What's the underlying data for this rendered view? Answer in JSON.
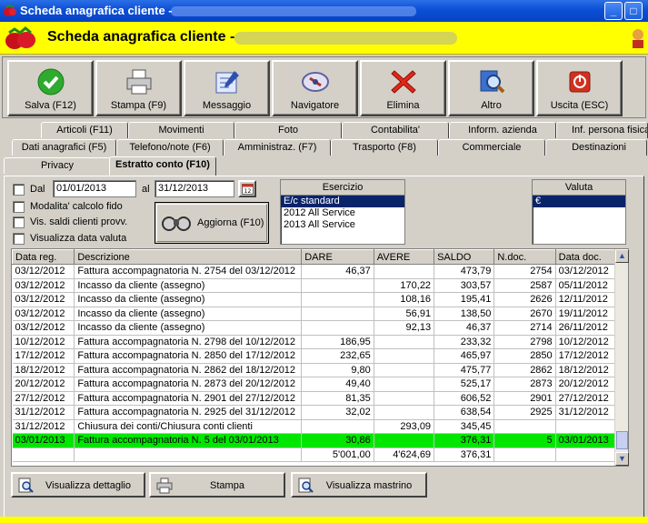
{
  "window": {
    "title": "Scheda anagrafica cliente -",
    "icon": "strawberry-icon"
  },
  "header": {
    "title": "Scheda anagrafica cliente -"
  },
  "toolbar": [
    {
      "label": "Salva (F12)",
      "icon": "check-icon"
    },
    {
      "label": "Stampa (F9)",
      "icon": "printer-icon"
    },
    {
      "label": "Messaggio",
      "icon": "message-icon"
    },
    {
      "label": "Navigatore",
      "icon": "navigator-icon"
    },
    {
      "label": "Elimina",
      "icon": "delete-icon"
    },
    {
      "label": "Altro",
      "icon": "magnifier-icon"
    },
    {
      "label": "Uscita (ESC)",
      "icon": "exit-icon"
    }
  ],
  "tabs_row1": [
    "Articoli (F11)",
    "Movimenti",
    "Foto",
    "Contabilita'",
    "Inform. azienda",
    "Inf. persona fisica"
  ],
  "tabs_row2": [
    "Dati anagrafici (F5)",
    "Telefono/note (F6)",
    "Amministraz. (F7)",
    "Trasporto (F8)",
    "Commerciale",
    "Destinazioni"
  ],
  "tabs_row3": [
    "Privacy",
    "Estratto conto (F10)"
  ],
  "filters": {
    "dal_label": "Dal",
    "dal_value": "01/01/2013",
    "al_label": "al",
    "al_value": "31/12/2013",
    "modalita_label": "Modalita' calcolo fido",
    "vis_saldi_label": "Vis. saldi clienti provv.",
    "vis_data_label": "Visualizza data valuta",
    "aggiorna_label": "Aggiorna (F10)"
  },
  "esercizio": {
    "header": "Esercizio",
    "items": [
      "E/c standard",
      "2012 All Service",
      "2013 All Service"
    ],
    "selected": 0
  },
  "valuta": {
    "header": "Valuta",
    "items": [
      "€"
    ],
    "selected": 0
  },
  "grid": {
    "columns": [
      "Data reg.",
      "Descrizione",
      "DARE",
      "AVERE",
      "SALDO",
      "N.doc.",
      "Data doc."
    ],
    "rows": [
      [
        "03/12/2012",
        "Fattura accompagnatoria N. 2754 del 03/12/2012",
        "46,37",
        "",
        "473,79",
        "2754",
        "03/12/2012"
      ],
      [
        "03/12/2012",
        "Incasso da cliente (assegno)",
        "",
        "170,22",
        "303,57",
        "2587",
        "05/11/2012"
      ],
      [
        "03/12/2012",
        "Incasso da cliente (assegno)",
        "",
        "108,16",
        "195,41",
        "2626",
        "12/11/2012"
      ],
      [
        "03/12/2012",
        "Incasso da cliente (assegno)",
        "",
        "56,91",
        "138,50",
        "2670",
        "19/11/2012"
      ],
      [
        "03/12/2012",
        "Incasso da cliente (assegno)",
        "",
        "92,13",
        "46,37",
        "2714",
        "26/11/2012"
      ],
      [
        "10/12/2012",
        "Fattura accompagnatoria N. 2798 del 10/12/2012",
        "186,95",
        "",
        "233,32",
        "2798",
        "10/12/2012"
      ],
      [
        "17/12/2012",
        "Fattura accompagnatoria N. 2850 del 17/12/2012",
        "232,65",
        "",
        "465,97",
        "2850",
        "17/12/2012"
      ],
      [
        "18/12/2012",
        "Fattura accompagnatoria N. 2862 del 18/12/2012",
        "9,80",
        "",
        "475,77",
        "2862",
        "18/12/2012"
      ],
      [
        "20/12/2012",
        "Fattura accompagnatoria N. 2873 del 20/12/2012",
        "49,40",
        "",
        "525,17",
        "2873",
        "20/12/2012"
      ],
      [
        "27/12/2012",
        "Fattura accompagnatoria N. 2901 del 27/12/2012",
        "81,35",
        "",
        "606,52",
        "2901",
        "27/12/2012"
      ],
      [
        "31/12/2012",
        "Fattura accompagnatoria N. 2925 del 31/12/2012",
        "32,02",
        "",
        "638,54",
        "2925",
        "31/12/2012"
      ],
      [
        "31/12/2012",
        "Chiusura dei conti/Chiusura conti clienti",
        "",
        "293,09",
        "345,45",
        "",
        ""
      ],
      [
        "03/01/2013",
        "Fattura accompagnatoria N. 5 del 03/01/2013",
        "30,86",
        "",
        "376,31",
        "5",
        "03/01/2013"
      ],
      [
        "",
        "",
        "5'001,00",
        "4'624,69",
        "376,31",
        "",
        ""
      ]
    ],
    "highlight_row": 12,
    "highlight_color": "#00e600"
  },
  "bottom_buttons": [
    {
      "label": "Visualizza dettaglio",
      "icon": "magnifier-doc-icon"
    },
    {
      "label": "Stampa",
      "icon": "printer-icon"
    },
    {
      "label": "Visualizza mastrino",
      "icon": "magnifier-doc-icon"
    }
  ],
  "colors": {
    "header_bg": "#ffff00",
    "titlebar": "#0b4fd6",
    "selection": "#0a246a"
  }
}
